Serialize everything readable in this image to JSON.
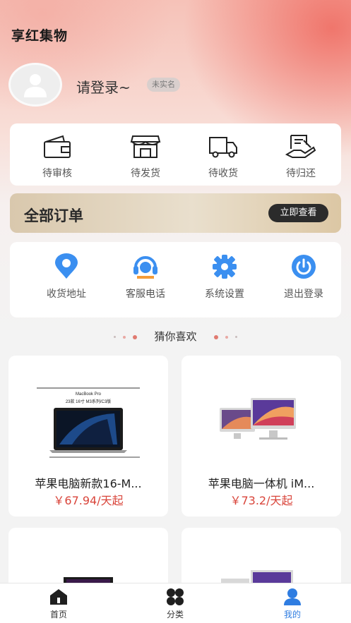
{
  "app": {
    "title": "享红集物"
  },
  "profile": {
    "login_text": "请登录~",
    "verify_badge": "未实名"
  },
  "order_status": [
    {
      "label": "待审核",
      "icon": "wallet-icon"
    },
    {
      "label": "待发货",
      "icon": "store-icon"
    },
    {
      "label": "待收货",
      "icon": "truck-icon"
    },
    {
      "label": "待归还",
      "icon": "return-hand-icon"
    }
  ],
  "orders_banner": {
    "title": "全部订单",
    "view_button": "立即查看"
  },
  "tools": [
    {
      "label": "收货地址",
      "icon": "location-pin-icon"
    },
    {
      "label": "客服电话",
      "icon": "headset-icon"
    },
    {
      "label": "系统设置",
      "icon": "gear-icon"
    },
    {
      "label": "退出登录",
      "icon": "power-icon"
    }
  ],
  "recommend": {
    "title": "猜你喜欢"
  },
  "products": [
    {
      "name": "苹果电脑新款16-M...",
      "price": "￥67.94/天起",
      "image_text": "MacBook Pro",
      "image_sub": "23款 16寸 M3系列/C3版"
    },
    {
      "name": "苹果电脑一体机 iM...",
      "price": "￥73.2/天起"
    },
    {
      "name": "",
      "price": ""
    },
    {
      "name": "",
      "price": ""
    }
  ],
  "tabbar": [
    {
      "label": "首页",
      "icon": "home-icon",
      "active": false
    },
    {
      "label": "分类",
      "icon": "category-icon",
      "active": false
    },
    {
      "label": "我的",
      "icon": "user-icon",
      "active": true
    }
  ],
  "colors": {
    "accent": "#2f7de1",
    "price": "#d9453b",
    "banner_dark": "#2b2b2b"
  }
}
